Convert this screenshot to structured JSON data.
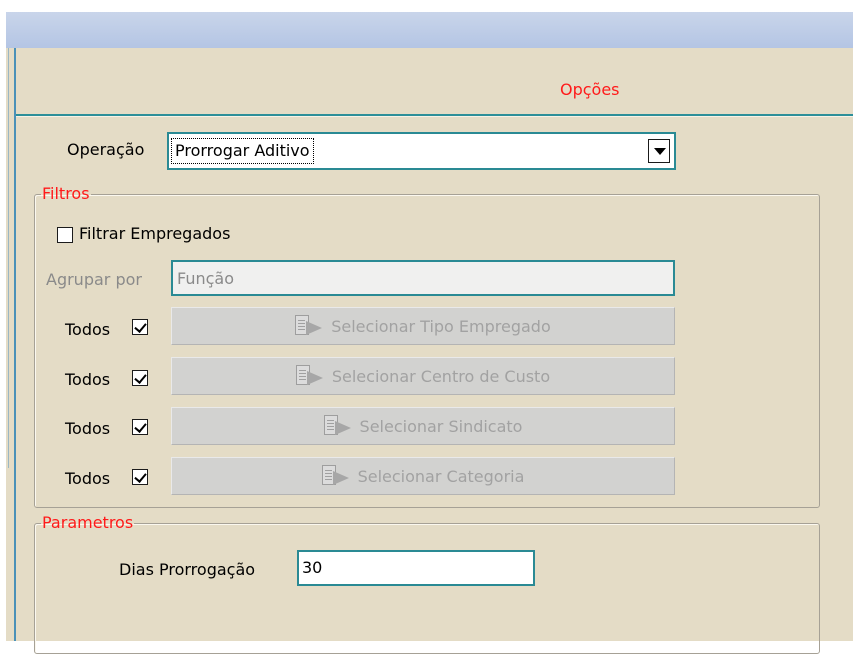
{
  "header": {
    "title": "Opções"
  },
  "operacao": {
    "label": "Operação",
    "value": "Prorrogar Aditivo"
  },
  "filtros": {
    "legend": "Filtros",
    "filtrar_empregados": {
      "label": "Filtrar Empregados",
      "checked": false
    },
    "agrupar_por": {
      "label": "Agrupar por",
      "value": "Função",
      "enabled": false
    },
    "rows": [
      {
        "todos_label": "Todos",
        "checked": true,
        "button_label": "Selecionar Tipo Empregado",
        "enabled": false
      },
      {
        "todos_label": "Todos",
        "checked": true,
        "button_label": "Selecionar Centro de Custo",
        "enabled": false
      },
      {
        "todos_label": "Todos",
        "checked": true,
        "button_label": "Selecionar Sindicato",
        "enabled": false
      },
      {
        "todos_label": "Todos",
        "checked": true,
        "button_label": "Selecionar Categoria",
        "enabled": false
      }
    ]
  },
  "parametros": {
    "legend": "Parametros",
    "dias_prorrogacao": {
      "label": "Dias Prorrogação",
      "value": "30"
    }
  },
  "colors": {
    "panel": "#e4dcc6",
    "title_bar": "#b4c5e4",
    "legend_text": "#ff1a1a",
    "focus_border": "#2a8a94"
  },
  "icons": {
    "select_button_icon": "document-arrow-icon",
    "combo_dropdown_icon": "chevron-down-icon"
  }
}
